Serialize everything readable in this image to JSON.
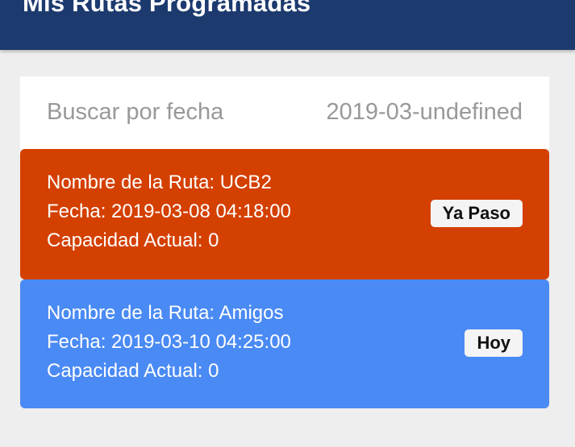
{
  "header": {
    "title": "Mis Rutas Programadas"
  },
  "search": {
    "label": "Buscar por fecha",
    "value": "2019-03-undefined"
  },
  "routes": [
    {
      "name": "Nombre de la Ruta: UCB2",
      "date": "Fecha: 2019-03-08 04:18:00",
      "capacity": "Capacidad Actual: 0",
      "status": "Ya Paso",
      "color": "#d44000"
    },
    {
      "name": "Nombre de la Ruta: Amigos",
      "date": "Fecha: 2019-03-10 04:25:00",
      "capacity": "Capacidad Actual: 0",
      "status": "Hoy",
      "color": "#4a8af4"
    }
  ],
  "colors": {
    "header": "#1c3a6e",
    "background": "#eeeeee"
  }
}
